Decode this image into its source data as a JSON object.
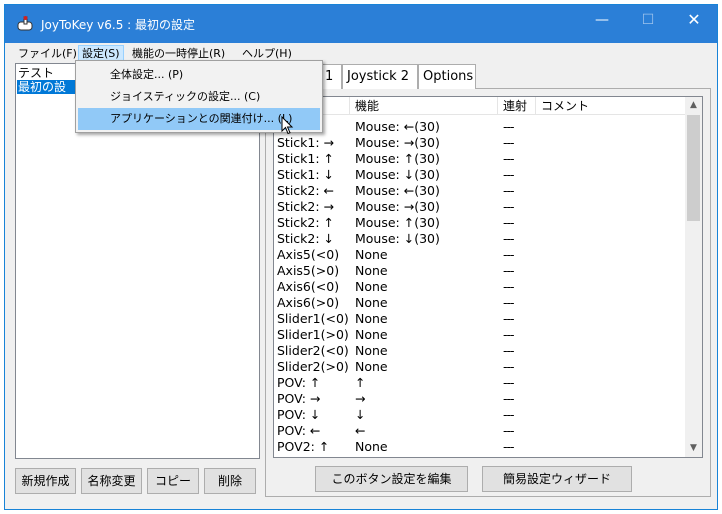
{
  "window": {
    "title": "JoyToKey v6.5 : 最初の設定"
  },
  "menu": {
    "file": "ファイル(F)",
    "settings": "設定(S)",
    "pause": "機能の一時停止(R)",
    "help": "ヘルプ(H)"
  },
  "dropdown": {
    "items": [
      "全体設定... (P)",
      "ジョイスティックの設定... (C)",
      "アプリケーションとの関連付け... (L)"
    ]
  },
  "profiles": [
    "テスト",
    "最初の設"
  ],
  "left_buttons": {
    "new": "新規作成",
    "rename": "名称変更",
    "copy": "コピー",
    "delete": "削除"
  },
  "tabs": [
    "1",
    "Joystick 2",
    "Options"
  ],
  "grid": {
    "headers": {
      "function": "機能",
      "repeat": "連射",
      "comment": "コメント"
    },
    "rows": [
      {
        "button": "←",
        "function": "Mouse: ←(30)",
        "repeat": "---"
      },
      {
        "button": "Stick1: →",
        "function": "Mouse: →(30)",
        "repeat": "---"
      },
      {
        "button": "Stick1: ↑",
        "function": "Mouse: ↑(30)",
        "repeat": "---"
      },
      {
        "button": "Stick1: ↓",
        "function": "Mouse: ↓(30)",
        "repeat": "---"
      },
      {
        "button": "Stick2: ←",
        "function": "Mouse: ←(30)",
        "repeat": "---"
      },
      {
        "button": "Stick2: →",
        "function": "Mouse: →(30)",
        "repeat": "---"
      },
      {
        "button": "Stick2: ↑",
        "function": "Mouse: ↑(30)",
        "repeat": "---"
      },
      {
        "button": "Stick2: ↓",
        "function": "Mouse: ↓(30)",
        "repeat": "---"
      },
      {
        "button": "Axis5(<0)",
        "function": "None",
        "repeat": "---"
      },
      {
        "button": "Axis5(>0)",
        "function": "None",
        "repeat": "---"
      },
      {
        "button": "Axis6(<0)",
        "function": "None",
        "repeat": "---"
      },
      {
        "button": "Axis6(>0)",
        "function": "None",
        "repeat": "---"
      },
      {
        "button": "Slider1(<0)",
        "function": "None",
        "repeat": "---"
      },
      {
        "button": "Slider1(>0)",
        "function": "None",
        "repeat": "---"
      },
      {
        "button": "Slider2(<0)",
        "function": "None",
        "repeat": "---"
      },
      {
        "button": "Slider2(>0)",
        "function": "None",
        "repeat": "---"
      },
      {
        "button": "POV: ↑",
        "function": "↑",
        "repeat": "---"
      },
      {
        "button": "POV: →",
        "function": "→",
        "repeat": "---"
      },
      {
        "button": "POV: ↓",
        "function": "↓",
        "repeat": "---"
      },
      {
        "button": "POV: ←",
        "function": "←",
        "repeat": "---"
      },
      {
        "button": "POV2: ↑",
        "function": "None",
        "repeat": "---"
      }
    ]
  },
  "bottom_buttons": {
    "edit": "このボタン設定を編集",
    "wizard": "簡易設定ウィザード"
  },
  "colors": {
    "titlebar": "#2b7fd7",
    "selection": "#0078d7",
    "menu_highlight": "#91c9f7"
  }
}
